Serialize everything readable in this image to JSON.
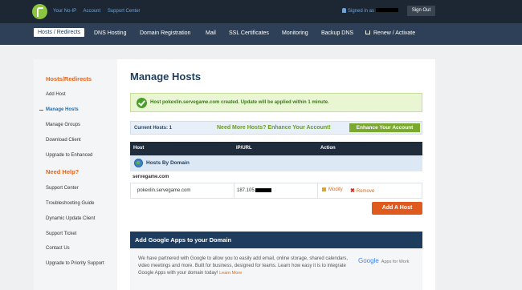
{
  "header": {
    "top_links": [
      "Your No-IP",
      "Account",
      "Support Center"
    ],
    "signed_in_label": "Signed in as",
    "sign_out_label": "Sign Out"
  },
  "nav": {
    "items": [
      "Hosts / Redirects",
      "DNS Hosting",
      "Domain Registration",
      "Mail",
      "SSL Certificates",
      "Monitoring",
      "Backup DNS",
      "Renew / Activate"
    ],
    "active": "Hosts / Redirects"
  },
  "sidebar": {
    "section1_title": "Hosts/Redirects",
    "items1": [
      "Add Host",
      "Manage Hosts",
      "Manage Groups",
      "Download Client",
      "Upgrade to Enhanced"
    ],
    "active_item": "Manage Hosts",
    "section2_title": "Need Help?",
    "items2": [
      "Support Center",
      "Troubleshooting Guide",
      "Dynamic Update Client",
      "Support Ticket",
      "Contact Us",
      "Upgrade to Priority Support"
    ]
  },
  "main": {
    "title": "Manage Hosts",
    "success_message": "Host pokexlin.servegame.com created. Update will be applied within 1 minute.",
    "current_hosts": "Current Hosts: 1",
    "need_more": "Need More Hosts? Enhance Your Account!",
    "enhance_button": "Enhance Your Account",
    "table": {
      "columns": [
        "Host",
        "IP/URL",
        "Action"
      ],
      "group_label": "Hosts By Domain",
      "domain": "servegame.com",
      "rows": [
        {
          "host": "pokexlin.servegame.com",
          "ip": "187.105.",
          "modify": "Modify",
          "remove": "Remove"
        }
      ]
    },
    "add_host_button": "Add A Host",
    "google_apps": {
      "heading": "Add Google Apps to your Domain",
      "body": "We have partnered with Google to allow you to easily add email, online storage, shared calendars, video meetings and more. Built for business, designed for teams. Learn how easy it is to integrate Google Apps with your domain today!",
      "learn_more": "Learn More",
      "logo_text": "Google",
      "logo_suffix": "Apps for Work"
    }
  },
  "colors": {
    "accent": "#e05a1e",
    "nav_bg": "#2e4057",
    "topbar_bg": "#1d2733",
    "success_bg": "#eaf5d3"
  }
}
